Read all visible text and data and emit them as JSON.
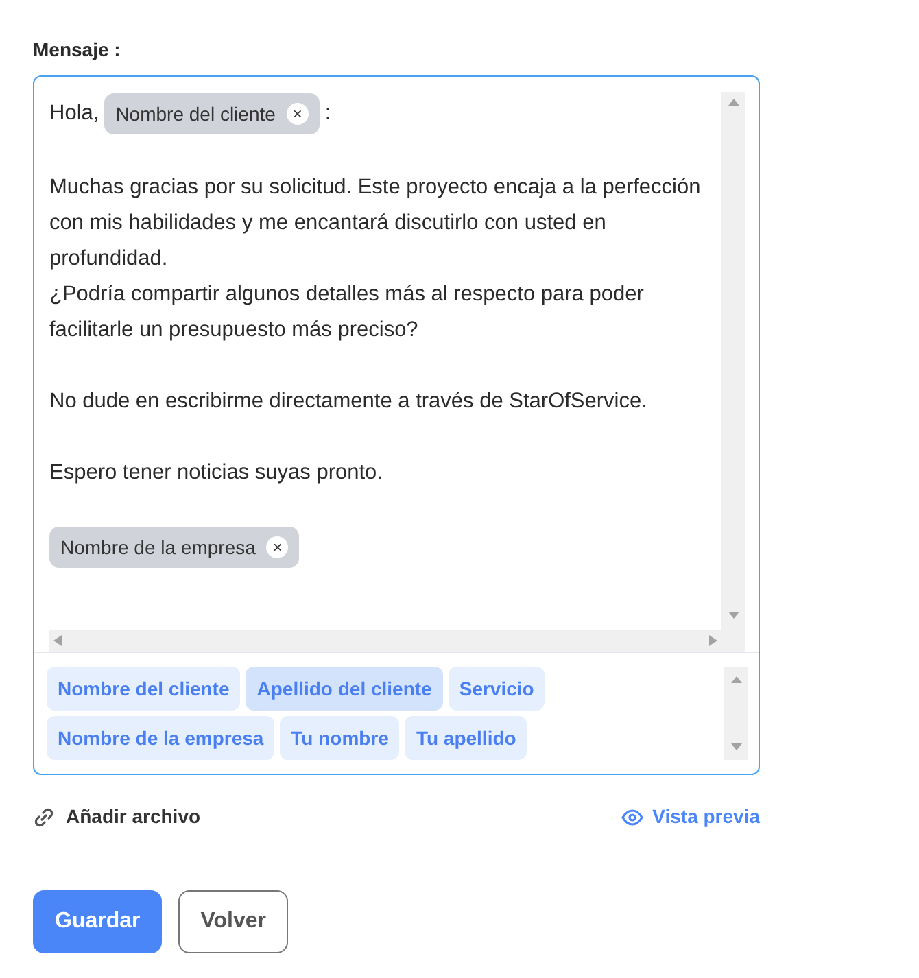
{
  "label": "Mensaje :",
  "message": {
    "paragraphs": [
      {
        "lines": [
          [
            {
              "kind": "text",
              "text": "Hola,"
            },
            {
              "kind": "chip",
              "text": "Nombre del cliente",
              "close": "×"
            },
            {
              "kind": "text",
              "text": ":"
            }
          ]
        ]
      },
      {
        "lines": [
          [
            {
              "kind": "text",
              "text": "Muchas gracias por su solicitud. Este proyecto encaja a la perfección con mis habilidades y me encantará discutirlo con usted en profundidad."
            }
          ],
          [
            {
              "kind": "text",
              "text": "¿Podría compartir algunos detalles más al respecto para poder facilitarle un presupuesto más preciso?"
            }
          ]
        ]
      },
      {
        "lines": [
          [
            {
              "kind": "text",
              "text": "No dude en escribirme directamente a través de StarOfService."
            }
          ]
        ]
      },
      {
        "lines": [
          [
            {
              "kind": "text",
              "text": "Espero tener noticias suyas pronto."
            }
          ]
        ]
      },
      {
        "lines": [
          [
            {
              "kind": "chip",
              "text": "Nombre de la empresa",
              "close": "×"
            }
          ]
        ]
      }
    ]
  },
  "variables": [
    {
      "label": "Nombre del cliente",
      "selected": false
    },
    {
      "label": "Apellido del cliente",
      "selected": true
    },
    {
      "label": "Servicio",
      "selected": false
    },
    {
      "label": "Nombre de la empresa",
      "selected": false
    },
    {
      "label": "Tu nombre",
      "selected": false
    },
    {
      "label": "Tu apellido",
      "selected": false
    }
  ],
  "attach": "Añadir archivo",
  "preview": "Vista previa",
  "buttons": [
    {
      "label": "Guardar",
      "kind": "primary"
    },
    {
      "label": "Volver",
      "kind": "secondary"
    }
  ]
}
